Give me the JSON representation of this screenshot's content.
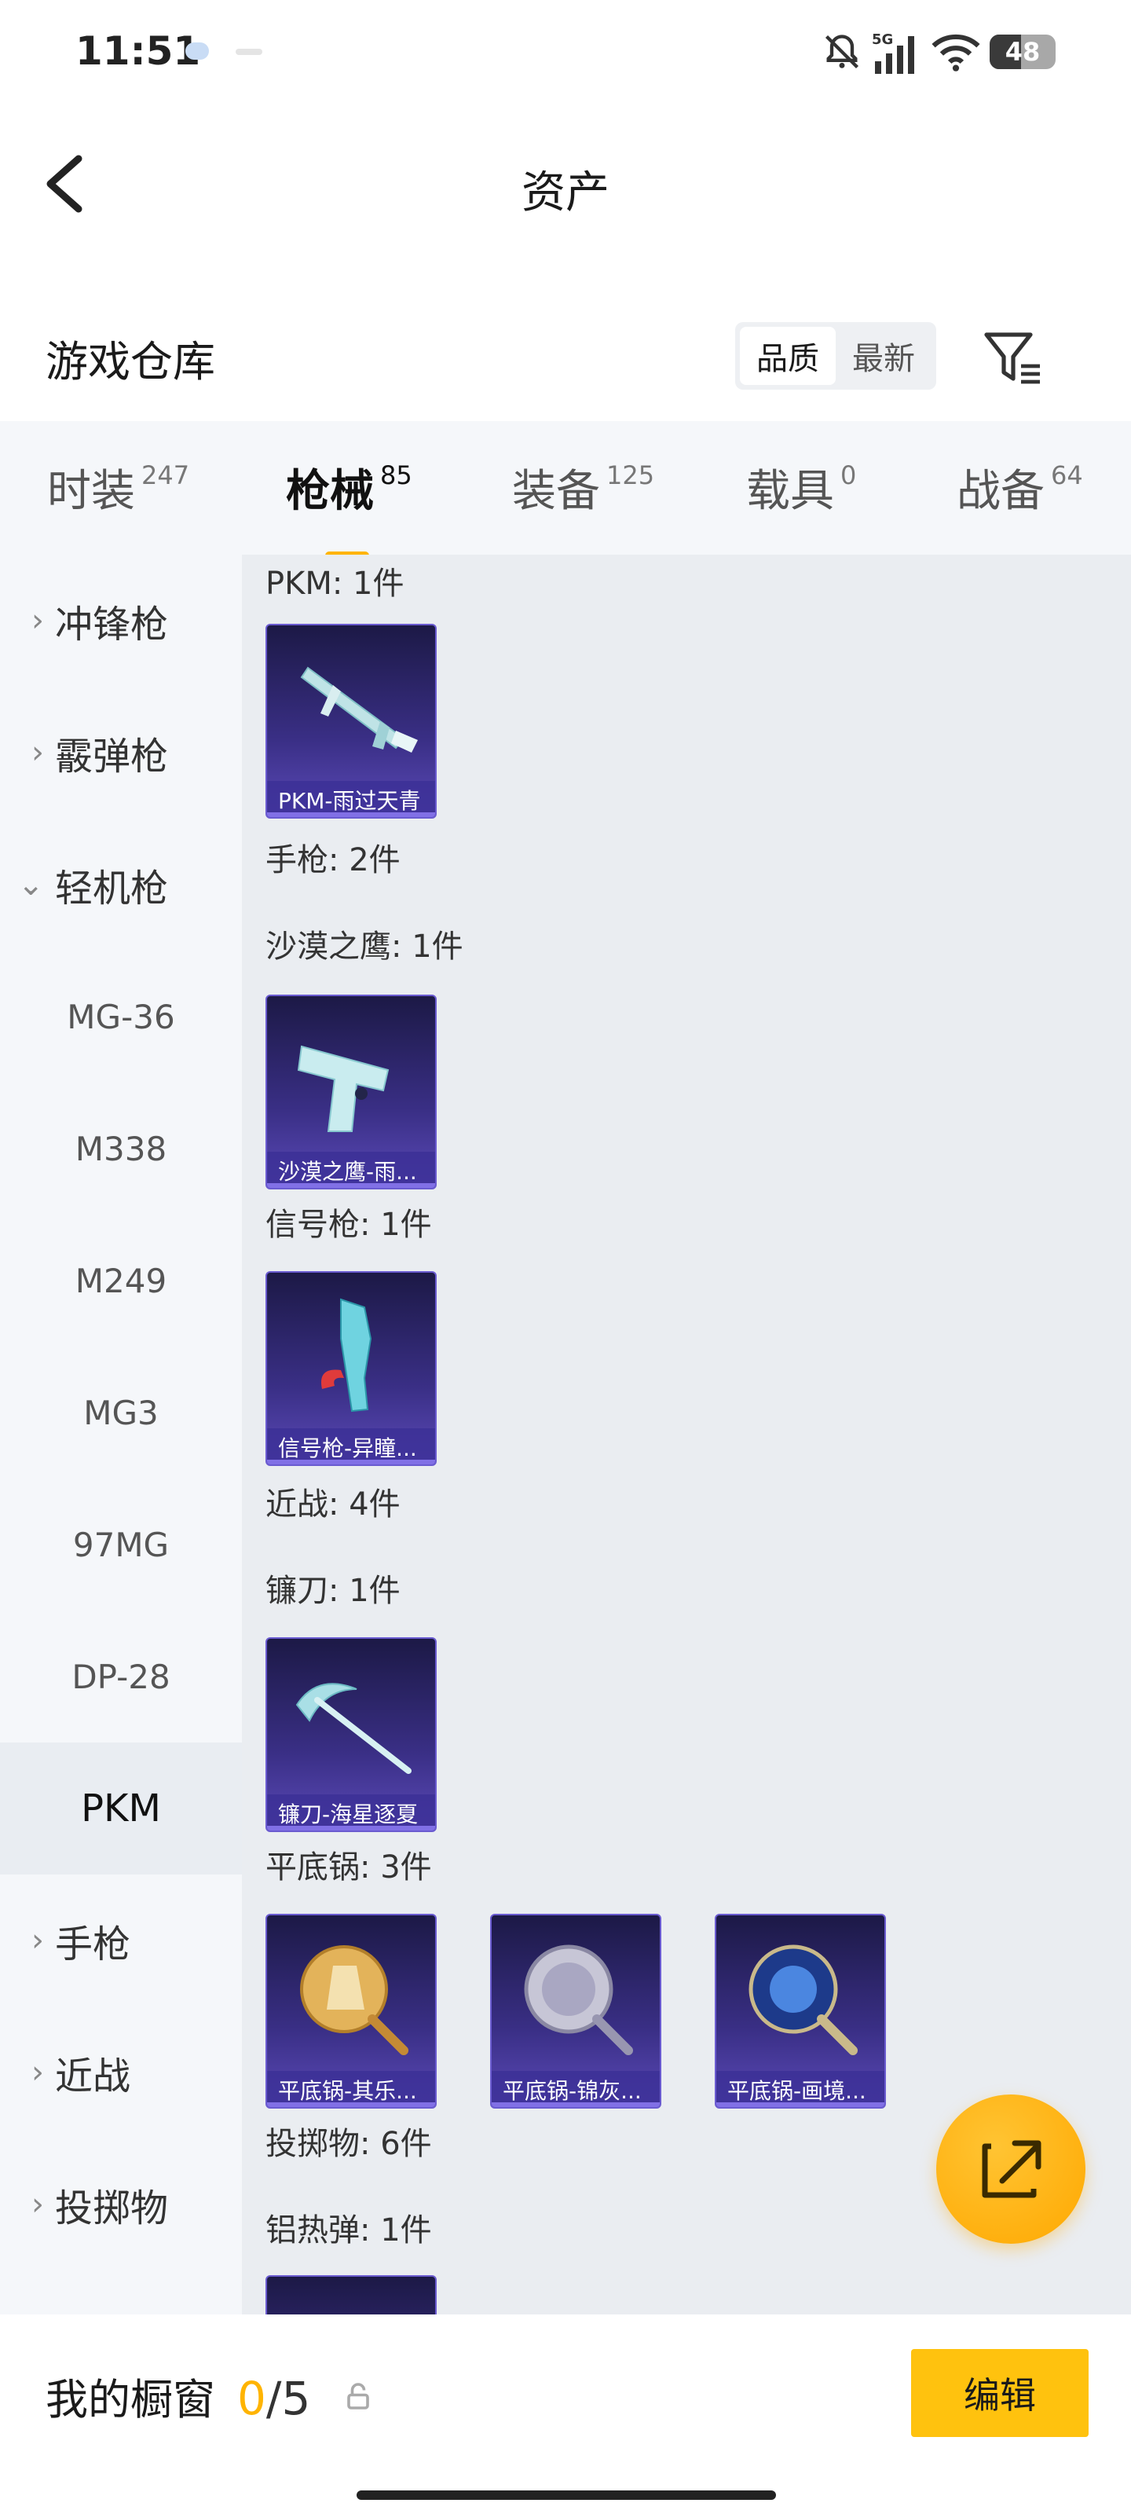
{
  "status_bar": {
    "time": "11:51",
    "network": "5G",
    "battery": "48"
  },
  "header": {
    "title": "资产"
  },
  "warehouse": {
    "title": "游戏仓库",
    "sort_options": [
      "品质",
      "最新"
    ],
    "active_sort": "品质"
  },
  "tabs": [
    {
      "label": "时装",
      "count": "247"
    },
    {
      "label": "枪械",
      "count": "85",
      "active": true
    },
    {
      "label": "装备",
      "count": "125"
    },
    {
      "label": "载具",
      "count": "0"
    },
    {
      "label": "战备",
      "count": "64"
    }
  ],
  "sidebar": {
    "items": [
      {
        "label": "冲锋枪",
        "type": "group",
        "chevron": "›"
      },
      {
        "label": "霰弹枪",
        "type": "group",
        "chevron": "›"
      },
      {
        "label": "轻机枪",
        "type": "group-open",
        "chevron": "⌄"
      },
      {
        "label": "MG-36",
        "type": "sub"
      },
      {
        "label": "M338",
        "type": "sub"
      },
      {
        "label": "M249",
        "type": "sub"
      },
      {
        "label": "MG3",
        "type": "sub"
      },
      {
        "label": "97MG",
        "type": "sub"
      },
      {
        "label": "DP-28",
        "type": "sub"
      },
      {
        "label": "PKM",
        "type": "sub",
        "selected": true
      },
      {
        "label": "手枪",
        "type": "group",
        "chevron": "›"
      },
      {
        "label": "近战",
        "type": "group",
        "chevron": "›"
      },
      {
        "label": "投掷物",
        "type": "group",
        "chevron": "›"
      }
    ]
  },
  "content": {
    "sections": [
      {
        "label": "PKM: 1件"
      },
      {
        "label": "手枪: 2件"
      },
      {
        "label": "沙漠之鹰: 1件"
      },
      {
        "label": "信号枪: 1件"
      },
      {
        "label": "近战: 4件"
      },
      {
        "label": "镰刀: 1件"
      },
      {
        "label": "平底锅: 3件"
      },
      {
        "label": "投掷物: 6件"
      },
      {
        "label": "铝热弹: 1件"
      }
    ],
    "items": [
      {
        "name": "PKM-雨过天青",
        "icon": "rifle-icon"
      },
      {
        "name": "沙漠之鹰-雨...",
        "icon": "pistol-icon"
      },
      {
        "name": "信号枪-异瞳...",
        "icon": "flare-gun-icon"
      },
      {
        "name": "镰刀-海星逐夏",
        "icon": "scythe-icon"
      },
      {
        "name": "平底锅-其乐...",
        "icon": "pan-icon"
      },
      {
        "name": "平底锅-锦灰...",
        "icon": "pan-icon"
      },
      {
        "name": "平底锅-画境...",
        "icon": "pan-icon"
      }
    ]
  },
  "bottom_bar": {
    "showcase_label": "我的橱窗",
    "current": "0",
    "total": "/5",
    "edit_label": "编辑"
  },
  "colors": {
    "accent": "#ffb400",
    "edit_button": "#ffc20e",
    "card_bg": "#2e2870",
    "card_border": "#6a5bd0"
  }
}
